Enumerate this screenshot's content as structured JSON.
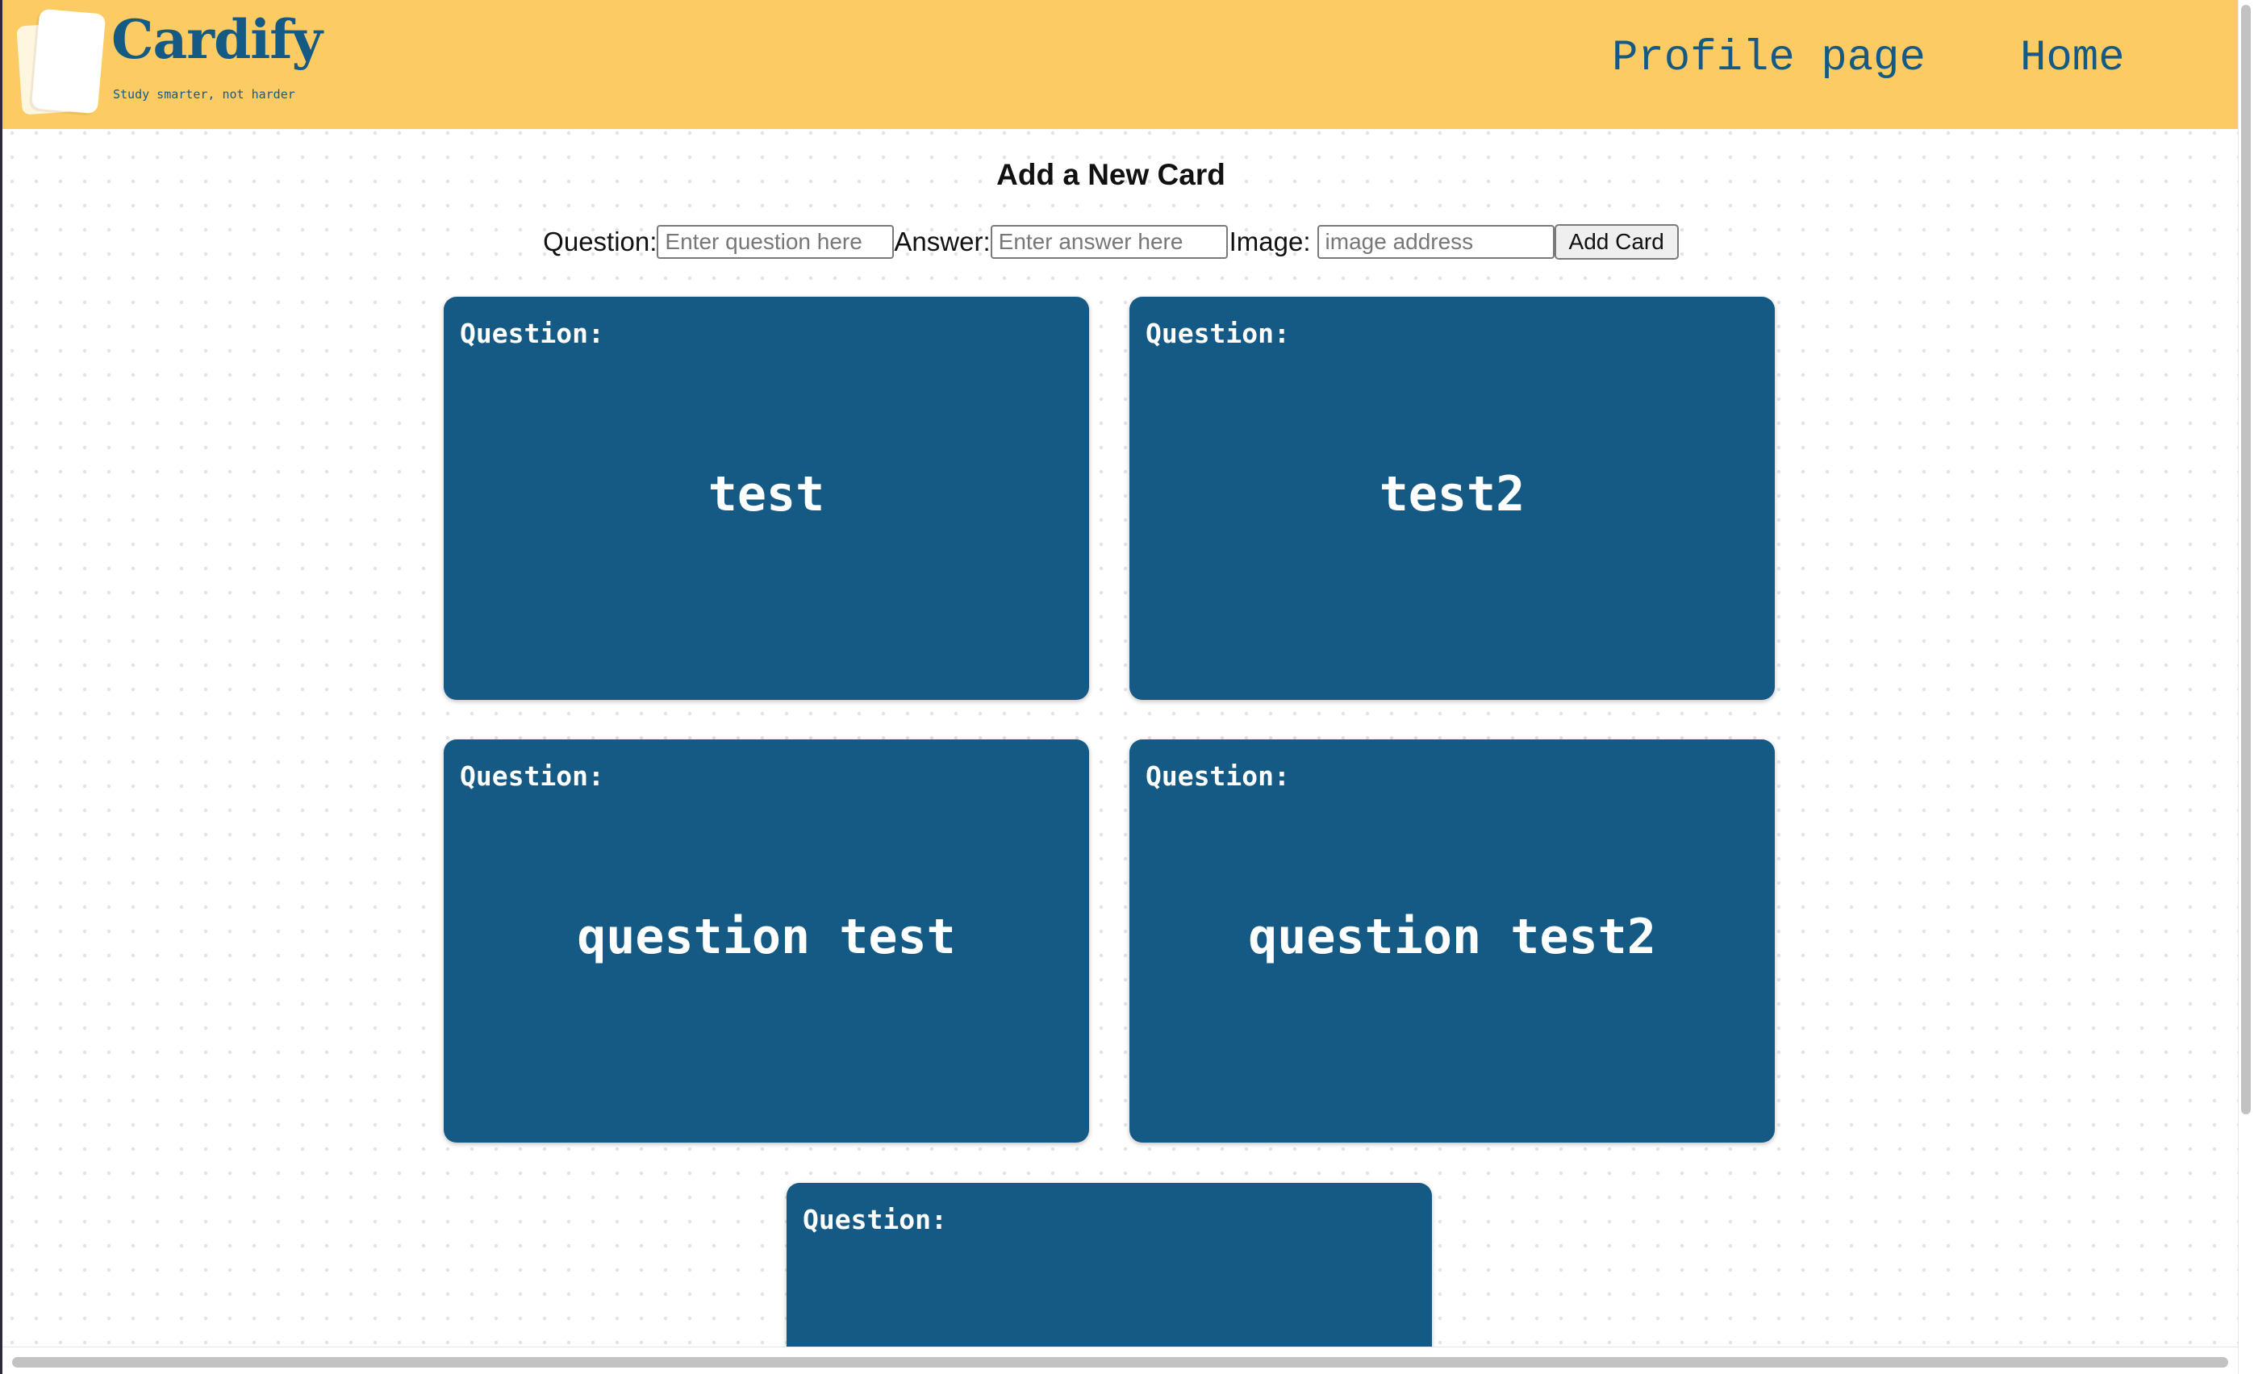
{
  "header": {
    "brand": "Cardify",
    "tagline": "Study smarter, not harder",
    "nav": [
      {
        "label": "Profile page"
      },
      {
        "label": "Home"
      }
    ]
  },
  "form": {
    "title": "Add a New Card",
    "question_label": "Question:",
    "question_placeholder": "Enter question here",
    "answer_label": "Answer:",
    "answer_placeholder": "Enter answer here",
    "image_label": "Image:",
    "image_placeholder": "image address",
    "submit_label": "Add Card"
  },
  "cards": [
    {
      "label": "Question:",
      "text": "test"
    },
    {
      "label": "Question:",
      "text": "test2"
    },
    {
      "label": "Question:",
      "text": "question test"
    },
    {
      "label": "Question:",
      "text": "question test2"
    },
    {
      "label": "Question:",
      "text": ""
    }
  ],
  "colors": {
    "header_bg": "#fdcb63",
    "brand": "#155a85",
    "card_bg": "#155a85",
    "card_text": "#ffffff"
  }
}
